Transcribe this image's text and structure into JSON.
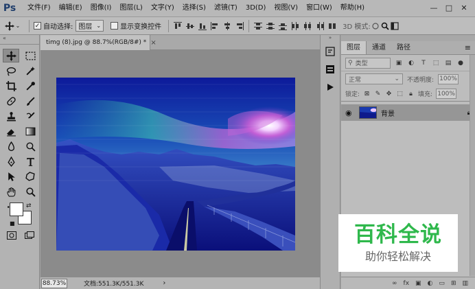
{
  "app": {
    "logo": "Ps",
    "menu": [
      "文件(F)",
      "编辑(E)",
      "图像(I)",
      "图层(L)",
      "文字(Y)",
      "选择(S)",
      "滤镜(T)",
      "3D(D)",
      "视图(V)",
      "窗口(W)",
      "帮助(H)"
    ],
    "window_controls": [
      "—",
      "□",
      "✕"
    ]
  },
  "options": {
    "auto_select_label": "自动选择:",
    "auto_select_value": "图层",
    "show_transform_label": "显示变换控件",
    "mode_3d_label": "3D 模式:"
  },
  "document": {
    "tab_title": "timg (8).jpg @ 88.7%(RGB/8#) *",
    "zoom": "88.73%",
    "doc_info": "文档:551.3K/551.3K"
  },
  "layers_panel": {
    "tabs": [
      "图层",
      "通道",
      "路径"
    ],
    "filter_placeholder": "类型",
    "blend_mode": "正常",
    "opacity_label": "不透明度:",
    "opacity_value": "100%",
    "lock_label": "锁定:",
    "fill_label": "填充:",
    "fill_value": "100%",
    "layers": [
      {
        "name": "背景",
        "visible": true,
        "locked": true
      }
    ],
    "bottom_icons": [
      "link-icon",
      "fx-icon",
      "mask-icon",
      "adjustment-icon",
      "folder-icon",
      "new-layer-icon",
      "trash-icon"
    ]
  },
  "watermark": {
    "main": "百科全说",
    "sub": "助你轻松解决"
  },
  "colors": {
    "foreground": "#ffffff",
    "background": "#ffffff",
    "watermark_green": "#2fb84c"
  }
}
